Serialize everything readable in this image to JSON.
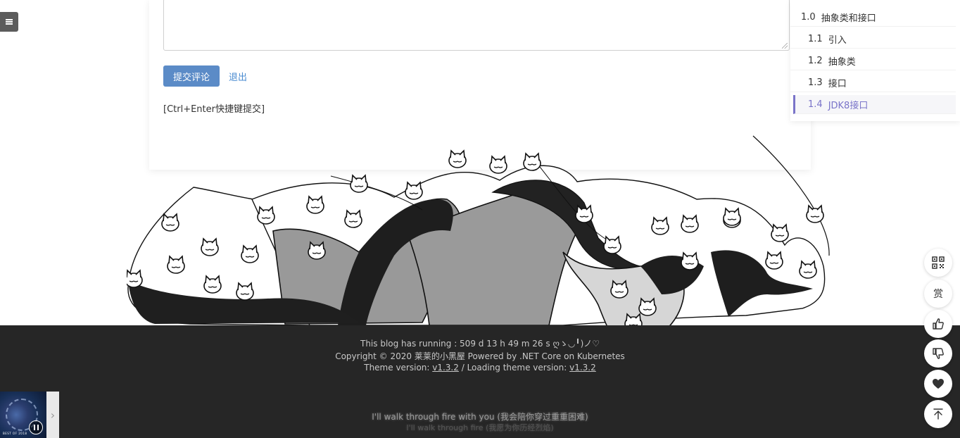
{
  "comment_form": {
    "submit_label": "提交评论",
    "logout_label": "退出",
    "shortcut_hint": "[Ctrl+Enter快捷键提交]"
  },
  "toc": {
    "items": [
      {
        "num": "1.0",
        "label": "抽象类和接口",
        "level": 0,
        "active": false
      },
      {
        "num": "1.1",
        "label": "引入",
        "level": 1,
        "active": false
      },
      {
        "num": "1.2",
        "label": "抽象类",
        "level": 1,
        "active": false
      },
      {
        "num": "1.3",
        "label": "接口",
        "level": 1,
        "active": false
      },
      {
        "num": "1.4",
        "label": "JDK8接口",
        "level": 1,
        "active": true
      }
    ],
    "active_color": "#7a74c9"
  },
  "footer": {
    "running": "This blog has running : 509 d 13 h 49 m 26 s ღゝ◡╹)ノ♡",
    "copyright": "Copyright © 2020 莱莱的小黑屋 Powered by .NET Core on Kubernetes",
    "theme_prefix": "Theme version: ",
    "theme_version": "v1.3.2",
    "loading_prefix": " / Loading theme version: ",
    "loading_version": "v1.3.2",
    "background": "#262626"
  },
  "player": {
    "lyric_main": "I'll walk through fire with you (我会陪你穿过重重困难)",
    "lyric_sub": "I'll walk through fire (我愿为你历经烈焰)",
    "cover_text": "BEST OF 2018",
    "state": "playing"
  },
  "float_buttons": [
    {
      "name": "qrcode-button",
      "icon": "qrcode-icon",
      "text": ""
    },
    {
      "name": "reward-button",
      "icon": "",
      "text": "赏"
    },
    {
      "name": "like-button",
      "icon": "thumbs-up-icon",
      "text": ""
    },
    {
      "name": "dislike-button",
      "icon": "thumbs-down-icon",
      "text": ""
    },
    {
      "name": "favorite-button",
      "icon": "heart-icon",
      "text": ""
    },
    {
      "name": "back-to-top-button",
      "icon": "arrow-up-icon",
      "text": ""
    }
  ],
  "accent_color": "#5b8bc7"
}
